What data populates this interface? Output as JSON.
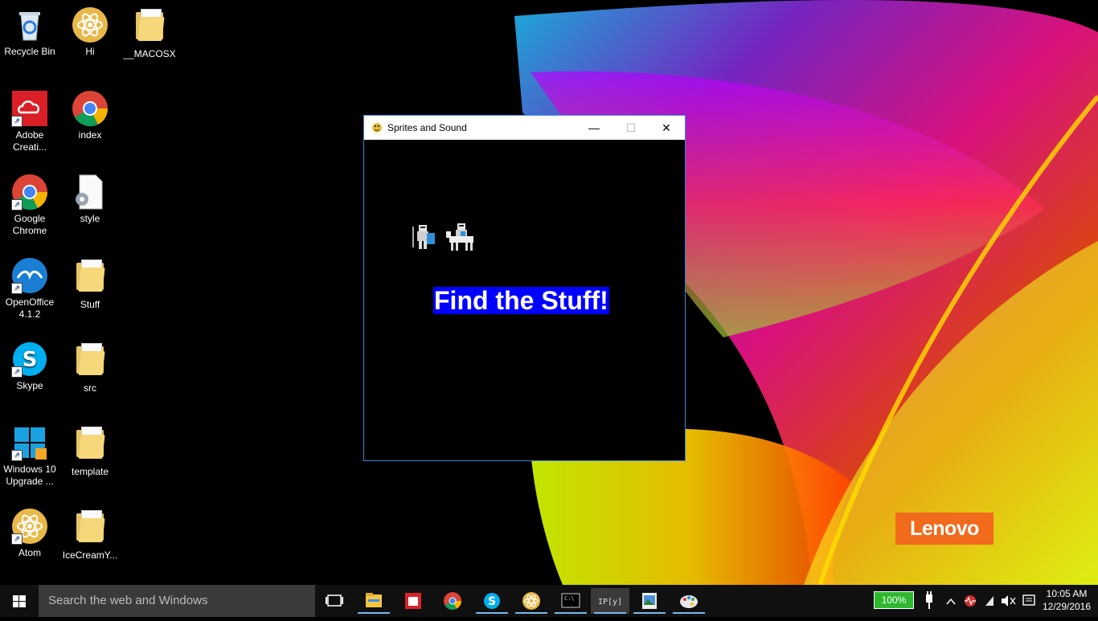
{
  "desktop": {
    "icons": [
      {
        "label": "Recycle Bin"
      },
      {
        "label": "Hi"
      },
      {
        "label": "__MACOSX"
      },
      {
        "label": "Adobe Creati..."
      },
      {
        "label": "index"
      },
      {
        "label": "Google Chrome"
      },
      {
        "label": "style"
      },
      {
        "label": "OpenOffice 4.1.2"
      },
      {
        "label": "Stuff"
      },
      {
        "label": "Skype"
      },
      {
        "label": "src"
      },
      {
        "label": "Windows 10 Upgrade ..."
      },
      {
        "label": "template"
      },
      {
        "label": "Atom"
      },
      {
        "label": "IceCreamY..."
      }
    ],
    "brand_logo": "Lenovo"
  },
  "window": {
    "title": "Sprites and Sound",
    "banner_text": "Find the Stuff!",
    "banner_color": "#0000ff"
  },
  "taskbar": {
    "search_placeholder": "Search the web and Windows",
    "apps": [
      "task-view",
      "file-explorer",
      "reader",
      "chrome",
      "skype",
      "atom",
      "cmd",
      "ipython",
      "paint-viewer",
      "paint"
    ],
    "active_app": "ipython",
    "battery": "100%",
    "time": "10:05 AM",
    "date": "12/29/2016"
  }
}
